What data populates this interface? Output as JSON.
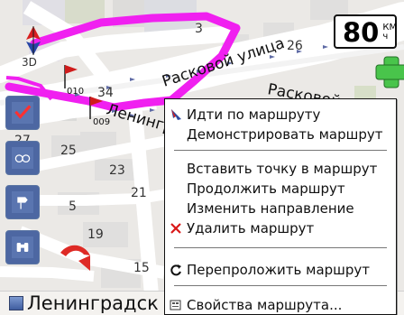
{
  "status": {
    "speed": "80",
    "speed_unit_top": "КМ",
    "speed_unit_bottom": "ч",
    "mode": "3D"
  },
  "map": {
    "street_labels": [
      "Расковой улица",
      "Расковой пр",
      "Ленингр"
    ],
    "house_numbers": [
      "3",
      "26",
      "34",
      "25",
      "23",
      "21",
      "5",
      "19",
      "15",
      "27"
    ],
    "route_markers": [
      "010",
      "009"
    ],
    "bottom_street": "Ленинградск"
  },
  "menu": {
    "items": [
      {
        "label": "Идти по маршруту",
        "icon": "navigate-icon"
      },
      {
        "label": "Демонстрировать маршрут",
        "icon": ""
      },
      {
        "label": "Вставить точку в маршрут",
        "icon": ""
      },
      {
        "label": "Продолжить маршрут",
        "icon": ""
      },
      {
        "label": "Изменить направление",
        "icon": ""
      },
      {
        "label": "Удалить маршрут",
        "icon": "delete-icon"
      },
      {
        "label": "Перепроложить маршрут",
        "icon": "refresh-icon"
      },
      {
        "label": "Свойства маршрута...",
        "icon": "properties-icon"
      }
    ]
  },
  "colors": {
    "route": "#f020f0",
    "menu_bg": "#ffffff",
    "toolbar": "#4d67a2",
    "accent_red": "#d91919",
    "green": "#49c44b"
  }
}
